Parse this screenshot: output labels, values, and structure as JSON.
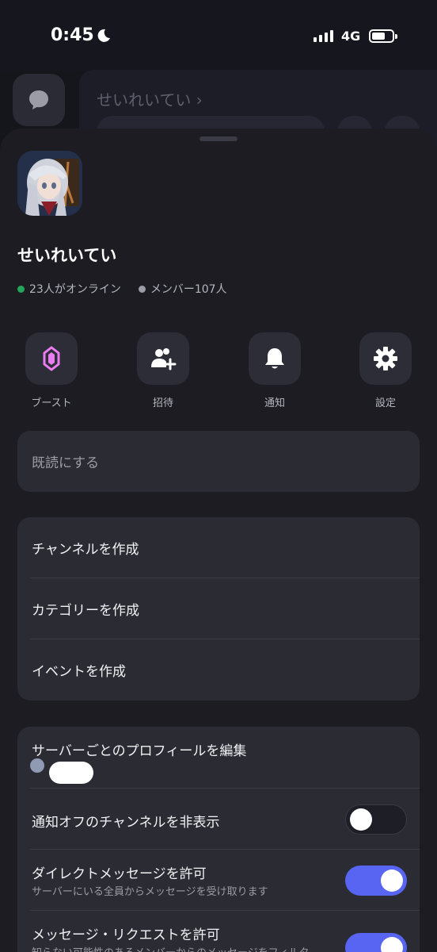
{
  "status_bar": {
    "time": "0:45",
    "network": "4G",
    "battery_level": 0.65
  },
  "background": {
    "server_title": "せいれいてい ›"
  },
  "server": {
    "name": "せいれいてい",
    "online": "23人がオンライン",
    "members": "メンバー107人",
    "online_color": "#23a55a",
    "member_color": "#9b9ca6"
  },
  "actions": [
    {
      "label": "ブースト",
      "icon": "boost-gem-icon"
    },
    {
      "label": "招待",
      "icon": "invite-user-icon"
    },
    {
      "label": "通知",
      "icon": "bell-icon"
    },
    {
      "label": "設定",
      "icon": "gear-icon"
    }
  ],
  "mark_read": "既読にする",
  "create": {
    "channel": "チャンネルを作成",
    "category": "カテゴリーを作成",
    "event": "イベントを作成"
  },
  "settings": {
    "edit_profile": "サーバーごとのプロフィールを編集",
    "hide_muted": {
      "label": "通知オフのチャンネルを非表示",
      "on": false
    },
    "allow_dm": {
      "label": "ダイレクトメッセージを許可",
      "sub": "サーバーにいる全員からメッセージを受け取ります",
      "on": true
    },
    "allow_requests": {
      "label": "メッセージ・リクエストを許可",
      "sub": "知らない可能性のあるメンバーからのメッセージをフィルタ",
      "on": true
    }
  },
  "colors": {
    "accent": "#5865f2",
    "boost": "#e87cf0"
  }
}
